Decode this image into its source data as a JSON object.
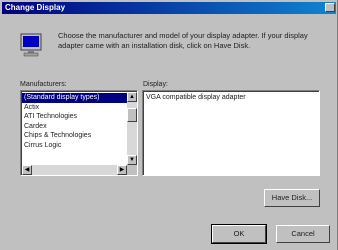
{
  "window": {
    "title": "Change Display"
  },
  "intro": {
    "text": "Choose the manufacturer and model of your display adapter. If your display adapter came with an installation disk, click on Have Disk."
  },
  "manufacturers": {
    "label": "Manufacturers:",
    "items": [
      "(Standard display types)",
      "Actix",
      "ATI Technologies",
      "Cardex",
      "Chips & Technologies",
      "Cirrus Logic"
    ],
    "selected_index": 0
  },
  "display": {
    "label": "Display:",
    "items": [
      "VGA compatible display adapter"
    ]
  },
  "buttons": {
    "have_disk": "Have Disk...",
    "ok": "OK",
    "cancel": "Cancel"
  },
  "icons": {
    "monitor": "monitor-icon",
    "close": "close-icon",
    "scroll_up": "scroll-up-arrow-icon",
    "scroll_down": "scroll-down-arrow-icon",
    "scroll_left": "scroll-left-arrow-icon",
    "scroll_right": "scroll-right-arrow-icon"
  },
  "colors": {
    "title_bar": "#000080",
    "selection": "#000080",
    "face": "#c0c0c0"
  }
}
